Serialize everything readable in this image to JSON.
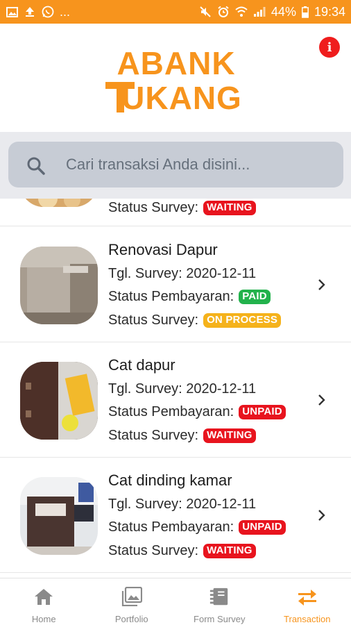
{
  "status_bar": {
    "left_icons": [
      "image-icon",
      "upload-icon",
      "whatsapp-icon"
    ],
    "more": "...",
    "battery": "44%",
    "time": "19:34"
  },
  "header": {
    "logo_line1": "ABANK",
    "logo_line2": "TUKANG",
    "info_icon": "i"
  },
  "search": {
    "placeholder": "Cari transaksi Anda disini..."
  },
  "labels": {
    "tgl_survey": "Tgl. Survey:",
    "status_pembayaran": "Status Pembayaran:",
    "status_survey": "Status Survey:"
  },
  "transactions": [
    {
      "title": "",
      "date": "",
      "payment_status": "",
      "survey_status": "WAITING"
    },
    {
      "title": "Renovasi Dapur",
      "date": "2020-12-11",
      "payment_status": "PAID",
      "survey_status": "ON PROCESS"
    },
    {
      "title": "Cat dapur",
      "date": "2020-12-11",
      "payment_status": "UNPAID",
      "survey_status": "WAITING"
    },
    {
      "title": "Cat dinding kamar",
      "date": "2020-12-11",
      "payment_status": "UNPAID",
      "survey_status": "WAITING"
    }
  ],
  "badge_colors": {
    "WAITING": "#e8141e",
    "UNPAID": "#e8141e",
    "PAID": "#22b24c",
    "ON PROCESS": "#f5b21b"
  },
  "bottom_nav": {
    "items": [
      {
        "label": "Home",
        "icon": "home-icon"
      },
      {
        "label": "Portfolio",
        "icon": "image-icon"
      },
      {
        "label": "Form Survey",
        "icon": "notebook-icon"
      },
      {
        "label": "Transaction",
        "icon": "swap-arrows-icon"
      }
    ],
    "active": "Transaction"
  },
  "colors": {
    "accent": "#f7941d",
    "search_bg": "#c7ccd5"
  }
}
